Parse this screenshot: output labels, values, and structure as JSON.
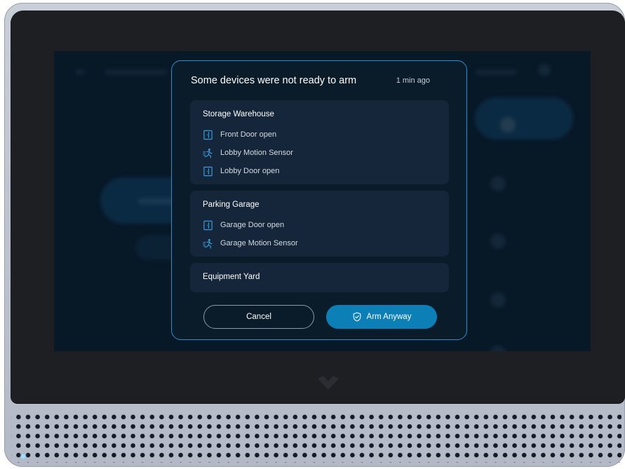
{
  "dialog": {
    "title": "Some devices were not ready to arm",
    "timestamp": "1 min ago",
    "groups": [
      {
        "name": "Storage Warehouse",
        "devices": [
          {
            "label": "Front Door open",
            "icon": "door-icon"
          },
          {
            "label": "Lobby Motion Sensor",
            "icon": "motion-sensor-icon"
          },
          {
            "label": "Lobby Door open",
            "icon": "door-icon"
          }
        ]
      },
      {
        "name": "Parking Garage",
        "devices": [
          {
            "label": "Garage Door open",
            "icon": "door-icon"
          },
          {
            "label": "Garage Motion Sensor",
            "icon": "motion-sensor-icon"
          }
        ]
      },
      {
        "name": "Equipment Yard",
        "devices": []
      }
    ],
    "cancel_label": "Cancel",
    "arm_label": "Arm Anyway",
    "arm_icon": "shield-check-icon"
  },
  "colors": {
    "accent": "#0b7fb6",
    "dialog_border": "#2c8fd0",
    "dialog_bg": "#0a1b2a",
    "group_bg": "#15263a",
    "icon_blue": "#3a9ad9"
  }
}
